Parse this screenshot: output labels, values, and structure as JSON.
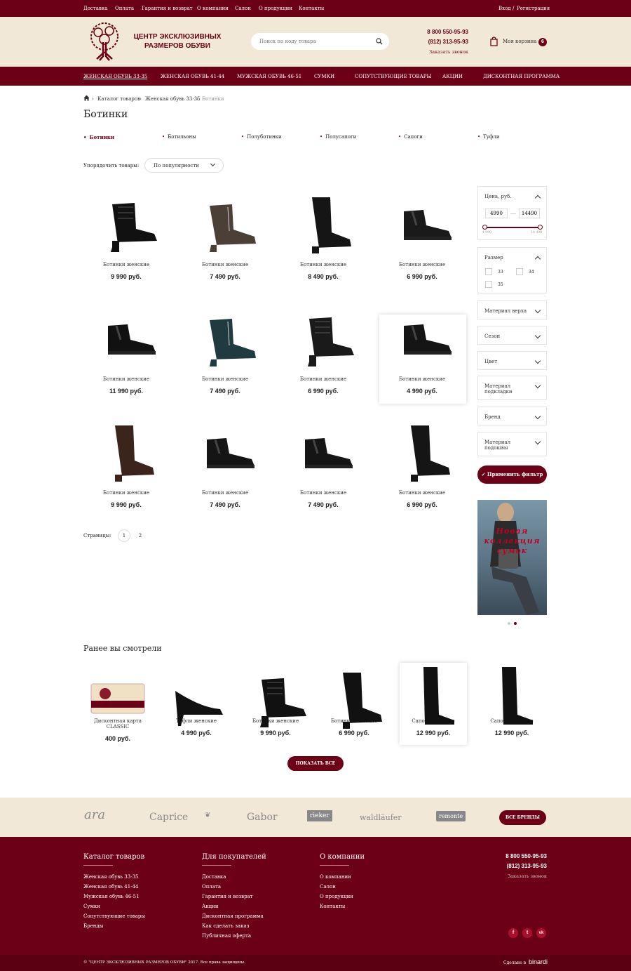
{
  "topbar": {
    "links": [
      "Доставка",
      "Оплата",
      "Гарантия и возврат",
      "О компании",
      "Салон",
      "О продукции",
      "Контакты"
    ],
    "login": "Вход",
    "sep": "/",
    "register": "Регистрация"
  },
  "header": {
    "logo_line1": "ЦЕНТР ЭКСКЛЮЗИВНЫХ",
    "logo_line2": "РАЗМЕРОВ ОБУВИ",
    "search_placeholder": "Поиск по коду товара",
    "phone1": "8 800 550-95-93",
    "phone2": "(812) 313-95-93",
    "callback": "Заказать звонок",
    "cart_label": "Моя корзина",
    "cart_count": "6"
  },
  "nav": [
    "ЖЕНСКАЯ ОБУВЬ 33-35",
    "ЖЕНСКАЯ ОБУВЬ 41-44",
    "МУЖСКАЯ ОБУВЬ 46-51",
    "СУМКИ",
    "СОПУТСТВУЮЩИЕ ТОВАРЫ",
    "АКЦИИ",
    "ДИСКОНТНАЯ ПРОГРАММА"
  ],
  "breadcrumb": [
    "Каталог товаров",
    "Женская обувь 33-35",
    "Ботинки"
  ],
  "page_title": "Ботинки",
  "subcategories": [
    "Ботинки",
    "Ботильоны",
    "Полуботинки",
    "Полусапоги",
    "Сапоги",
    "Туфли"
  ],
  "sort": {
    "label": "Упорядочить товары:",
    "value": "По популярности"
  },
  "products": [
    {
      "name": "Ботинки женские",
      "price": "9 990 руб."
    },
    {
      "name": "Ботинки женские",
      "price": "7 490 руб."
    },
    {
      "name": "Ботинки женские",
      "price": "8 490 руб."
    },
    {
      "name": "Ботинки женские",
      "price": "6 990 руб."
    },
    {
      "name": "Ботинки женские",
      "price": "11 990 руб."
    },
    {
      "name": "Ботинки женские",
      "price": "7 490 руб."
    },
    {
      "name": "Ботинки женские",
      "price": "6 990 руб."
    },
    {
      "name": "Ботинки женские",
      "price": "4 990 руб."
    },
    {
      "name": "Ботинки женские",
      "price": "9 990 руб."
    },
    {
      "name": "Ботинки женские",
      "price": "7 490 руб."
    },
    {
      "name": "Ботинки женские",
      "price": "7 490 руб."
    },
    {
      "name": "Ботинки женские",
      "price": "6 990 руб."
    }
  ],
  "pagination": {
    "label": "Страницы:",
    "pages": [
      "1",
      "2"
    ]
  },
  "filters": {
    "price": {
      "label": "Цена, руб.",
      "min": "4990",
      "max": "14490",
      "scale_min": "4 990",
      "scale_max": "14 490"
    },
    "size": {
      "label": "Размер",
      "options": [
        "33",
        "34",
        "35"
      ]
    },
    "collapsed": [
      "Материал верха",
      "Сезон",
      "Цвет",
      "Материал подкладки",
      "Бренд",
      "Материал подошвы"
    ],
    "apply": "Применить фильтр"
  },
  "banner": {
    "text1": "Новая",
    "text2": "коллекция",
    "text3": "сумок"
  },
  "recent": {
    "title": "Ранее вы смотрели",
    "items": [
      {
        "name": "Дисконтная карта CLASSIC",
        "price": "400 руб."
      },
      {
        "name": "Туфли женские",
        "price": "4 990 руб."
      },
      {
        "name": "Ботинки женские",
        "price": "9 990 руб."
      },
      {
        "name": "Ботинки женские",
        "price": "6 990 руб."
      },
      {
        "name": "Сапоги женские",
        "price": "12 990 руб."
      },
      {
        "name": "Сапоги женские",
        "price": "12 990 руб."
      }
    ],
    "show_all": "ПОКАЗАТЬ ВСЕ"
  },
  "brands": {
    "items": [
      "ara",
      "Caprice",
      "Gabor",
      "rieker",
      "waldläufer",
      "remonte"
    ],
    "all": "ВСЕ БРЕНДЫ"
  },
  "footer": {
    "col1": {
      "title": "Каталог товаров",
      "links": [
        "Женская обувь 33-35",
        "Женская обувь 41-44",
        "Мужская обувь 46-51",
        "Сумки",
        "Сопутствующие товары",
        "Бренды"
      ]
    },
    "col2": {
      "title": "Для покупателей",
      "links": [
        "Доставка",
        "Оплата",
        "Гарантия и возврат",
        "Акции",
        "Дисконтная программа",
        "Как сделать заказ",
        "Публичная оферта"
      ]
    },
    "col3": {
      "title": "О компании",
      "links": [
        "О компании",
        "Салон",
        "О продукции",
        "Контакты"
      ]
    },
    "phone1": "8 800 550-95-93",
    "phone2": "(812) 313-95-93",
    "callback": "Заказать звонок",
    "copyright": "© \"ЦЕНТР ЭКСКЛЮЗИВНЫХ РАЗМЕРОВ ОБУВИ\" 2017. Все права защищены.",
    "made_by": "Сделано в",
    "made_by_brand": "binardi"
  },
  "colors": {
    "brand": "#6b0016",
    "cream": "#f1e8d8"
  }
}
